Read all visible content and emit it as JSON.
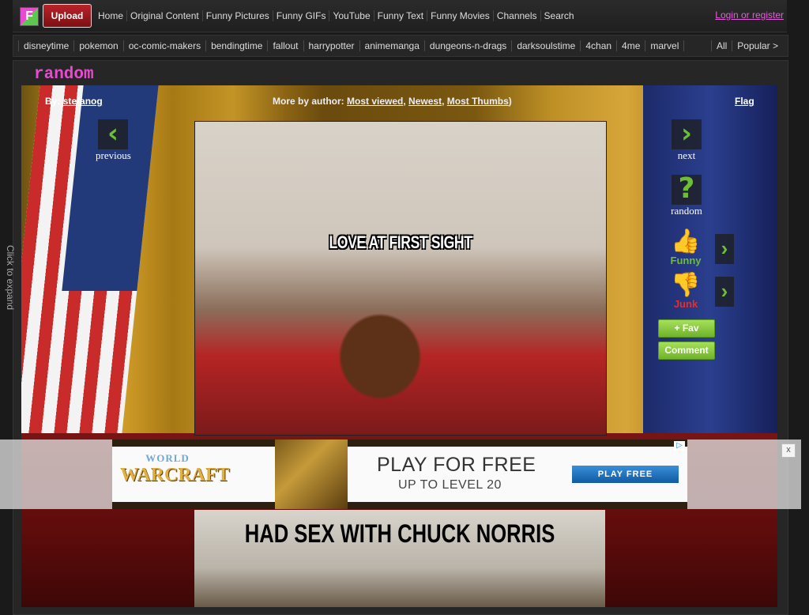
{
  "topnav": {
    "logo_letter": "F",
    "upload": "Upload",
    "links": [
      "Home",
      "Original Content",
      "Funny Pictures",
      "Funny GIFs",
      "YouTube",
      "Funny Text",
      "Funny Movies",
      "Channels",
      "Search"
    ],
    "login": "Login or register"
  },
  "tagbar": {
    "tags": [
      "disneytime",
      "pokemon",
      "oc-comic-makers",
      "bendingtime",
      "fallout",
      "harrypotter",
      "animemanga",
      "dungeons-n-drags",
      "darksoulstime",
      "4chan",
      "4me",
      "marvel"
    ],
    "all": "All",
    "popular": "Popular >"
  },
  "content": {
    "category": "random",
    "expand": "Click to expand",
    "by_label": "By:",
    "author": "stefanog",
    "more_by_label": "More by author:",
    "more_by_links": [
      "Most viewed",
      "Newest",
      "Most Thumbs"
    ],
    "flag": "Flag",
    "image_caption_top": "LOVE AT FIRST SIGHT",
    "image_caption_bottom": "HAD SEX WITH CHUCK NORRIS"
  },
  "controls": {
    "previous": "previous",
    "next": "next",
    "random": "random",
    "funny": "Funny",
    "junk": "Junk",
    "fav": "+ Fav",
    "comment": "Comment"
  },
  "ad": {
    "logo_top": "WORLD",
    "logo_bottom": "WARCRAFT",
    "headline": "PLAY FOR FREE",
    "subline": "UP TO LEVEL 20",
    "cta": "PLAY FREE",
    "close": "x"
  },
  "colors": {
    "accent_pink": "#e84ad0",
    "arrow_green": "#6dbe34",
    "upload_red": "#b8242a",
    "junk_red": "#e03030"
  }
}
